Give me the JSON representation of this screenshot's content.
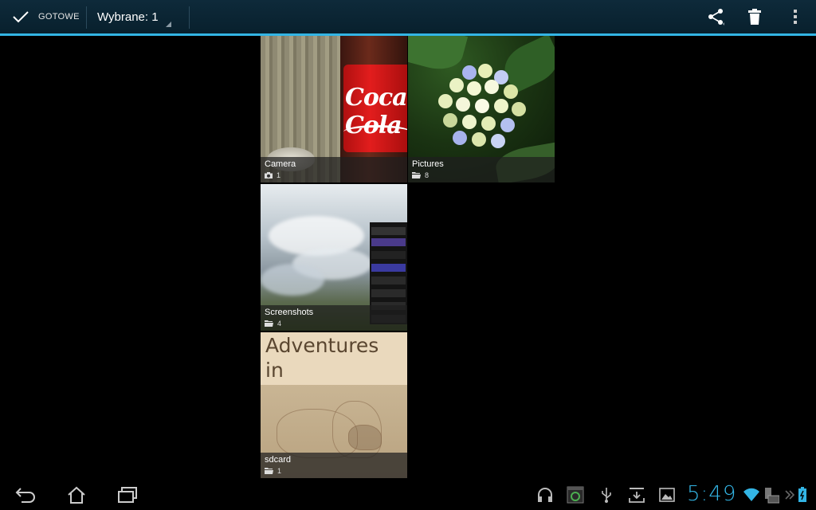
{
  "action_bar": {
    "done_label": "GOTOWE",
    "selection_title": "Wybrane: 1",
    "icons": [
      "check-icon",
      "share-icon",
      "trash-icon",
      "overflow-menu-icon"
    ],
    "accent_color": "#33b5e5"
  },
  "albums": [
    {
      "name": "Camera",
      "count": "1",
      "icon": "camera-icon",
      "selected": true
    },
    {
      "name": "Pictures",
      "count": "8",
      "icon": "folder-icon",
      "selected": false
    },
    {
      "name": "Screenshots",
      "count": "4",
      "icon": "folder-icon",
      "selected": false
    },
    {
      "name": "sdcard",
      "count": "1",
      "icon": "folder-icon",
      "selected": false
    }
  ],
  "thumbnails": {
    "camera_text": "Coca-Cola",
    "book_title_line1": "Adventures",
    "book_title_line2": "in Wonderland"
  },
  "system_bar": {
    "clock": "5:49",
    "nav_icons": [
      "back-icon",
      "home-icon",
      "recent-apps-icon"
    ],
    "status_icons": [
      "headphones-icon",
      "screenshot-app-icon",
      "usb-icon",
      "download-icon",
      "gallery-icon",
      "wifi-icon",
      "keyboard-icon",
      "battery-icon"
    ]
  }
}
